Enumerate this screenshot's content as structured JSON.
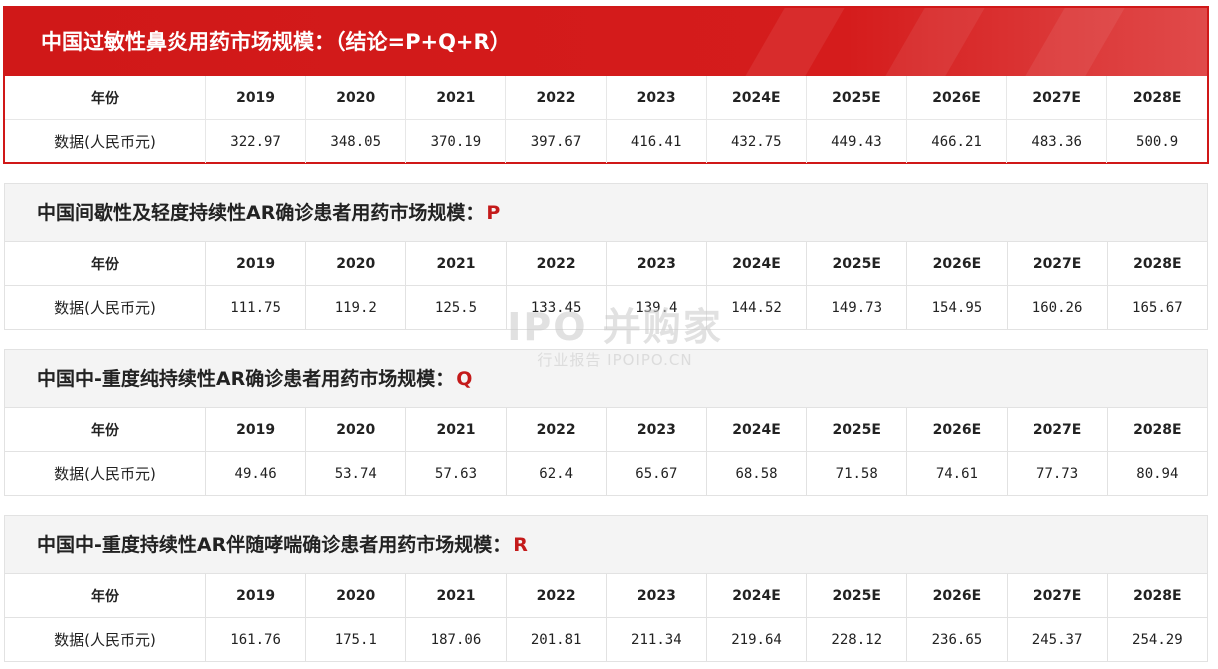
{
  "sections": [
    {
      "title": "中国过敏性鼻炎用药市场规模：（结论=P+Q+R）",
      "mark": "",
      "header_label": "年份",
      "years": [
        "2019",
        "2020",
        "2021",
        "2022",
        "2023",
        "2024E",
        "2025E",
        "2026E",
        "2027E",
        "2028E"
      ],
      "row_label": "数据(人民币元)",
      "values": [
        "322.97",
        "348.05",
        "370.19",
        "397.67",
        "416.41",
        "432.75",
        "449.43",
        "466.21",
        "483.36",
        "500.9"
      ]
    },
    {
      "title": "中国间歇性及轻度持续性AR确诊患者用药市场规模：",
      "mark": "P",
      "header_label": "年份",
      "years": [
        "2019",
        "2020",
        "2021",
        "2022",
        "2023",
        "2024E",
        "2025E",
        "2026E",
        "2027E",
        "2028E"
      ],
      "row_label": "数据(人民币元)",
      "values": [
        "111.75",
        "119.2",
        "125.5",
        "133.45",
        "139.4",
        "144.52",
        "149.73",
        "154.95",
        "160.26",
        "165.67"
      ]
    },
    {
      "title": "中国中-重度纯持续性AR确诊患者用药市场规模：",
      "mark": "Q",
      "header_label": "年份",
      "years": [
        "2019",
        "2020",
        "2021",
        "2022",
        "2023",
        "2024E",
        "2025E",
        "2026E",
        "2027E",
        "2028E"
      ],
      "row_label": "数据(人民币元)",
      "values": [
        "49.46",
        "53.74",
        "57.63",
        "62.4",
        "65.67",
        "68.58",
        "71.58",
        "74.61",
        "77.73",
        "80.94"
      ]
    },
    {
      "title": "中国中-重度持续性AR伴随哮喘确诊患者用药市场规模：",
      "mark": "R",
      "header_label": "年份",
      "years": [
        "2019",
        "2020",
        "2021",
        "2022",
        "2023",
        "2024E",
        "2025E",
        "2026E",
        "2027E",
        "2028E"
      ],
      "row_label": "数据(人民币元)",
      "values": [
        "161.76",
        "175.1",
        "187.06",
        "201.81",
        "211.34",
        "219.64",
        "228.12",
        "236.65",
        "245.37",
        "254.29"
      ]
    }
  ],
  "watermark": {
    "main": "IPO 并购家",
    "sub": "行业报告 IPOIPO.CN"
  }
}
